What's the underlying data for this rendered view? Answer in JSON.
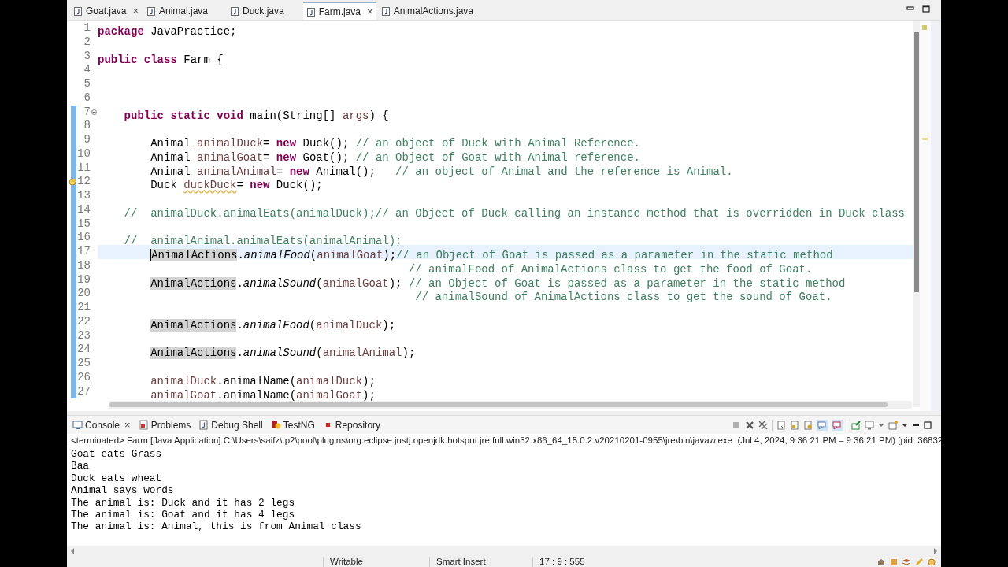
{
  "editor_tabs": [
    {
      "label": "Goat.java",
      "selected": false,
      "close": "×"
    },
    {
      "label": "Animal.java",
      "selected": false
    },
    {
      "label": "Duck.java",
      "selected": false
    },
    {
      "label": "Farm.java",
      "selected": true,
      "close": "×"
    },
    {
      "label": "AnimalActions.java",
      "selected": false
    }
  ],
  "code_lines": [
    {
      "number": "1",
      "scope": false,
      "fold": false,
      "warning": false,
      "current": false,
      "tokens": [
        {
          "kind": "kw",
          "text": "package"
        },
        {
          "kind": "plain",
          "text": " JavaPractice;"
        }
      ]
    },
    {
      "number": "2",
      "scope": false,
      "fold": false,
      "warning": false,
      "current": false
    },
    {
      "number": "3",
      "scope": false,
      "fold": false,
      "warning": false,
      "current": false,
      "tokens": [
        {
          "kind": "kw",
          "text": "public class"
        },
        {
          "kind": "plain",
          "text": " Farm {"
        }
      ]
    },
    {
      "number": "4",
      "scope": false,
      "fold": false,
      "warning": false,
      "current": false
    },
    {
      "number": "5",
      "scope": false,
      "fold": false,
      "warning": false,
      "current": false
    },
    {
      "number": "6",
      "scope": false,
      "fold": false,
      "warning": false,
      "current": false
    },
    {
      "number": "7",
      "scope": true,
      "fold": true,
      "warning": false,
      "current": false,
      "tokens": [
        {
          "kind": "kw",
          "text": "    public static void"
        },
        {
          "kind": "plain",
          "text": " main(String[] "
        },
        {
          "kind": "var",
          "text": "args"
        },
        {
          "kind": "plain",
          "text": ") {"
        }
      ]
    },
    {
      "number": "8",
      "scope": true,
      "fold": false,
      "warning": false,
      "current": false
    },
    {
      "number": "9",
      "scope": true,
      "fold": false,
      "warning": false,
      "current": false,
      "tokens": [
        {
          "kind": "plain",
          "text": "        Animal "
        },
        {
          "kind": "var",
          "text": "animalDuck"
        },
        {
          "kind": "plain",
          "text": "= "
        },
        {
          "kind": "kw",
          "text": "new"
        },
        {
          "kind": "plain",
          "text": " Duck(); "
        },
        {
          "kind": "comment",
          "text": "// an object of Duck with Animal Reference."
        }
      ]
    },
    {
      "number": "10",
      "scope": true,
      "fold": false,
      "warning": false,
      "current": false,
      "tokens": [
        {
          "kind": "plain",
          "text": "        Animal "
        },
        {
          "kind": "var",
          "text": "animalGoat"
        },
        {
          "kind": "plain",
          "text": "= "
        },
        {
          "kind": "kw",
          "text": "new"
        },
        {
          "kind": "plain",
          "text": " Goat(); "
        },
        {
          "kind": "comment",
          "text": "// an Object of Goat with Animal reference."
        }
      ]
    },
    {
      "number": "11",
      "scope": true,
      "fold": false,
      "warning": false,
      "current": false,
      "tokens": [
        {
          "kind": "plain",
          "text": "        Animal "
        },
        {
          "kind": "var",
          "text": "animalAnimal"
        },
        {
          "kind": "plain",
          "text": "= "
        },
        {
          "kind": "kw",
          "text": "new"
        },
        {
          "kind": "plain",
          "text": " Animal();   "
        },
        {
          "kind": "comment",
          "text": "// an object of Animal and the reference is Animal."
        }
      ]
    },
    {
      "number": "12",
      "scope": true,
      "fold": false,
      "warning": true,
      "current": false,
      "tokens": [
        {
          "kind": "plain",
          "text": "        Duck "
        },
        {
          "kind": "unused",
          "text": "duckDuck"
        },
        {
          "kind": "plain",
          "text": "= "
        },
        {
          "kind": "kw",
          "text": "new"
        },
        {
          "kind": "plain",
          "text": " Duck();"
        }
      ]
    },
    {
      "number": "13",
      "scope": true,
      "fold": false,
      "warning": false,
      "current": false
    },
    {
      "number": "14",
      "scope": true,
      "fold": false,
      "warning": false,
      "current": false,
      "tokens": [
        {
          "kind": "comment",
          "text": "    //  animalDuck.animalEats(animalDuck);// an Object of Duck calling an instance method that is overridden in Duck class"
        }
      ]
    },
    {
      "number": "15",
      "scope": true,
      "fold": false,
      "warning": false,
      "current": false
    },
    {
      "number": "16",
      "scope": true,
      "fold": false,
      "warning": false,
      "current": false,
      "tokens": [
        {
          "kind": "comment",
          "text": "    //  animalAnimal.animalEats(animalAnimal);"
        }
      ]
    },
    {
      "number": "17",
      "scope": true,
      "fold": false,
      "warning": false,
      "current": true,
      "tokens": [
        {
          "kind": "occurrence",
          "text": "AnimalActions"
        },
        {
          "kind": "plain",
          "text": "."
        },
        {
          "kind": "static",
          "text": "animalFood"
        },
        {
          "kind": "plain",
          "text": "("
        },
        {
          "kind": "var",
          "text": "animalGoat"
        },
        {
          "kind": "plain",
          "text": ");"
        },
        {
          "kind": "comment",
          "text": "// an Object of Goat is passed as a parameter in the static method"
        }
      ]
    },
    {
      "number": "18",
      "scope": true,
      "fold": false,
      "warning": false,
      "current": false,
      "tokens": [
        {
          "kind": "comment",
          "text": "                                               // animalFood of AnimalActions class to get the food of Goat."
        }
      ]
    },
    {
      "number": "19",
      "scope": true,
      "fold": false,
      "warning": false,
      "current": false,
      "tokens": [
        {
          "kind": "occurrence",
          "text": "AnimalActions"
        },
        {
          "kind": "plain",
          "text": "."
        },
        {
          "kind": "static",
          "text": "animalSound"
        },
        {
          "kind": "plain",
          "text": "("
        },
        {
          "kind": "var",
          "text": "animalGoat"
        },
        {
          "kind": "plain",
          "text": "); "
        },
        {
          "kind": "comment",
          "text": "// an Object of Goat is passed as a parameter in the static method"
        }
      ]
    },
    {
      "number": "20",
      "scope": true,
      "fold": false,
      "warning": false,
      "current": false,
      "tokens": [
        {
          "kind": "comment",
          "text": "                                                // animalSound of AnimalActions class to get the sound of Goat."
        }
      ]
    },
    {
      "number": "21",
      "scope": true,
      "fold": false,
      "warning": false,
      "current": false
    },
    {
      "number": "22",
      "scope": true,
      "fold": false,
      "warning": false,
      "current": false,
      "tokens": [
        {
          "kind": "occurrence",
          "text": "AnimalActions"
        },
        {
          "kind": "plain",
          "text": "."
        },
        {
          "kind": "static",
          "text": "animalFood"
        },
        {
          "kind": "plain",
          "text": "("
        },
        {
          "kind": "var",
          "text": "animalDuck"
        },
        {
          "kind": "plain",
          "text": ");"
        }
      ]
    },
    {
      "number": "23",
      "scope": true,
      "fold": false,
      "warning": false,
      "current": false
    },
    {
      "number": "24",
      "scope": true,
      "fold": false,
      "warning": false,
      "current": false,
      "tokens": [
        {
          "kind": "occurrence",
          "text": "AnimalActions"
        },
        {
          "kind": "plain",
          "text": "."
        },
        {
          "kind": "static",
          "text": "animalSound"
        },
        {
          "kind": "plain",
          "text": "("
        },
        {
          "kind": "var",
          "text": "animalAnimal"
        },
        {
          "kind": "plain",
          "text": ");"
        }
      ]
    },
    {
      "number": "25",
      "scope": true,
      "fold": false,
      "warning": false,
      "current": false
    },
    {
      "number": "26",
      "scope": true,
      "fold": false,
      "warning": false,
      "current": false,
      "tokens": [
        {
          "kind": "var",
          "text": "        animalDuck"
        },
        {
          "kind": "plain",
          "text": ".animalName("
        },
        {
          "kind": "var",
          "text": "animalDuck"
        },
        {
          "kind": "plain",
          "text": ");"
        }
      ]
    },
    {
      "number": "27",
      "scope": true,
      "fold": false,
      "warning": false,
      "current": false,
      "tokens": [
        {
          "kind": "var",
          "text": "        animalGoat"
        },
        {
          "kind": "plain",
          "text": ".animalName("
        },
        {
          "kind": "var",
          "text": "animalGoat"
        },
        {
          "kind": "plain",
          "text": ");"
        }
      ]
    }
  ],
  "console_tabs": [
    {
      "label": "Console",
      "kind": "console",
      "close": "×"
    },
    {
      "label": "Problems",
      "kind": "problems"
    },
    {
      "label": "Debug Shell",
      "kind": "java"
    },
    {
      "label": "TestNG",
      "kind": "testng"
    },
    {
      "label": "Repository",
      "kind": "repository"
    }
  ],
  "console_header": "<terminated> Farm [Java Application] C:\\Users\\saifz\\.p2\\pool\\plugins\\org.eclipse.justj.openjdk.hotspot.jre.full.win32.x86_64_15.0.2.v20210201-0955\\jre\\bin\\javaw.exe  (Jul 4, 2024, 9:36:21 PM – 9:36:21 PM) [pid: 36832",
  "console_output": [
    "Goat eats Grass",
    "Baa",
    "Duck eats wheat",
    "Animal says words",
    "The animal is: Duck and it has 2 legs",
    "The animal is: Goat and it has 4 legs",
    "The animal is: Animal, this is from Animal class"
  ],
  "status_bar": {
    "mode": "Writable",
    "insert_mode": "Smart Insert",
    "position": "17 : 9 : 555"
  }
}
